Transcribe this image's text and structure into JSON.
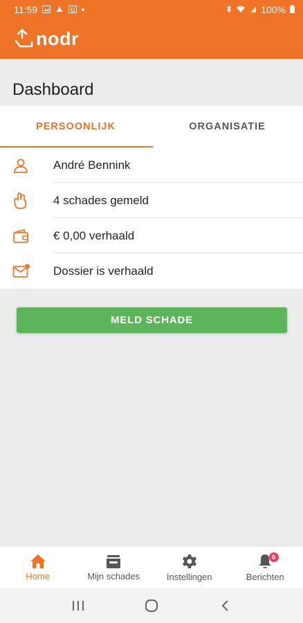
{
  "status_bar": {
    "time": "11:59",
    "battery": "100%"
  },
  "app_bar": {
    "logo_text": "nodr"
  },
  "page": {
    "title": "Dashboard"
  },
  "tabs": [
    {
      "label": "PERSOONLIJK",
      "active": true
    },
    {
      "label": "ORGANISATIE",
      "active": false
    }
  ],
  "info_rows": [
    {
      "icon": "person-icon",
      "text": "André Bennink"
    },
    {
      "icon": "hand-icon",
      "text": "4 schades gemeld"
    },
    {
      "icon": "wallet-icon",
      "text": "€ 0,00 verhaald"
    },
    {
      "icon": "mail-notification-icon",
      "text": "Dossier is verhaald"
    }
  ],
  "primary_button": {
    "label": "MELD SCHADE",
    "color": "#5cb55b"
  },
  "bottom_nav": [
    {
      "icon": "home-icon",
      "label": "Home",
      "active": true
    },
    {
      "icon": "archive-icon",
      "label": "Mijn schades",
      "active": false
    },
    {
      "icon": "gear-icon",
      "label": "Instellingen",
      "active": false
    },
    {
      "icon": "bell-icon",
      "label": "Berichten",
      "active": false,
      "badge": "0"
    }
  ],
  "colors": {
    "brand": "#f07427",
    "accent_green": "#5cb55b",
    "badge_red": "#e8425e",
    "background": "#ececec"
  }
}
